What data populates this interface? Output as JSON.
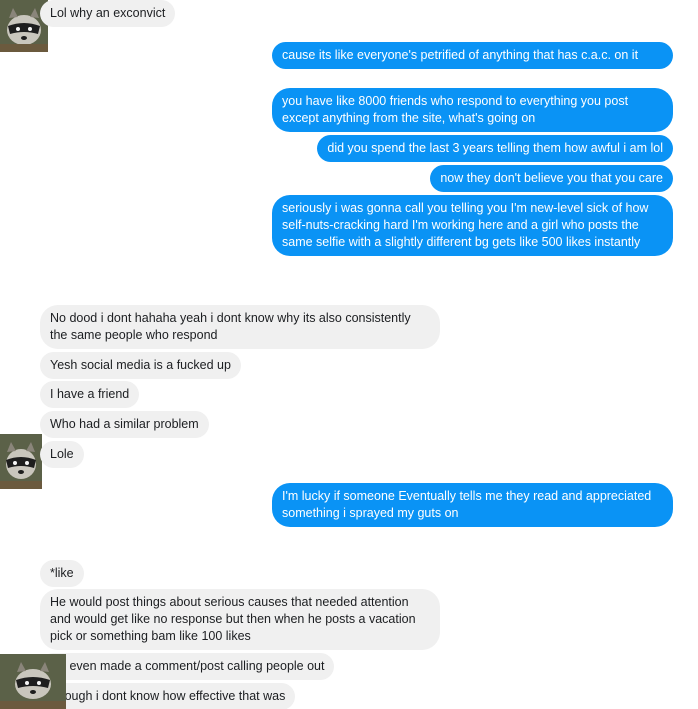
{
  "conversation": {
    "messages": [
      {
        "from": "them",
        "text": "Lol why an exconvict"
      },
      {
        "from": "me",
        "text": "cause its like everyone's petrified of anything that has c.a.c. on it"
      },
      {
        "from": "me",
        "text": "you have like 8000 friends who respond to everything you post except anything from the site, what's going on"
      },
      {
        "from": "me",
        "text": "did you spend the last 3 years telling them how awful i am lol"
      },
      {
        "from": "me",
        "text": "now they don't believe you that you care"
      },
      {
        "from": "me",
        "text": "seriously i was gonna call you telling you I'm new-level sick of how self-nuts-cracking hard I'm working here and a girl who posts the same selfie with a slightly different bg gets like 500 likes instantly"
      },
      {
        "from": "them",
        "text": "No dood i dont hahaha yeah i dont know why its also consistently the same people who respond"
      },
      {
        "from": "them",
        "text": "Yesh social media is a fucked up"
      },
      {
        "from": "them",
        "text": "I have a friend"
      },
      {
        "from": "them",
        "text": "Who had a similar problem"
      },
      {
        "from": "them",
        "text": "Lole"
      },
      {
        "from": "me",
        "text": "I'm lucky if someone Eventually tells me they read and appreciated something i sprayed my guts on"
      },
      {
        "from": "them",
        "text": "*like"
      },
      {
        "from": "them",
        "text": "He would post things about serious causes that needed attention and would get like no response but then when he posts a vacation pick or something bam like 100 likes"
      },
      {
        "from": "them",
        "text": "He even made a comment/post calling people out"
      },
      {
        "from": "them",
        "text": "Though i dont know how effective that was"
      }
    ]
  },
  "colors": {
    "sent_bubble": "#0a93f5",
    "received_bubble": "#f0f0f0",
    "sent_text": "#ffffff",
    "received_text": "#1c1e21"
  },
  "icons": {
    "avatar": "raccoon-avatar-icon"
  }
}
